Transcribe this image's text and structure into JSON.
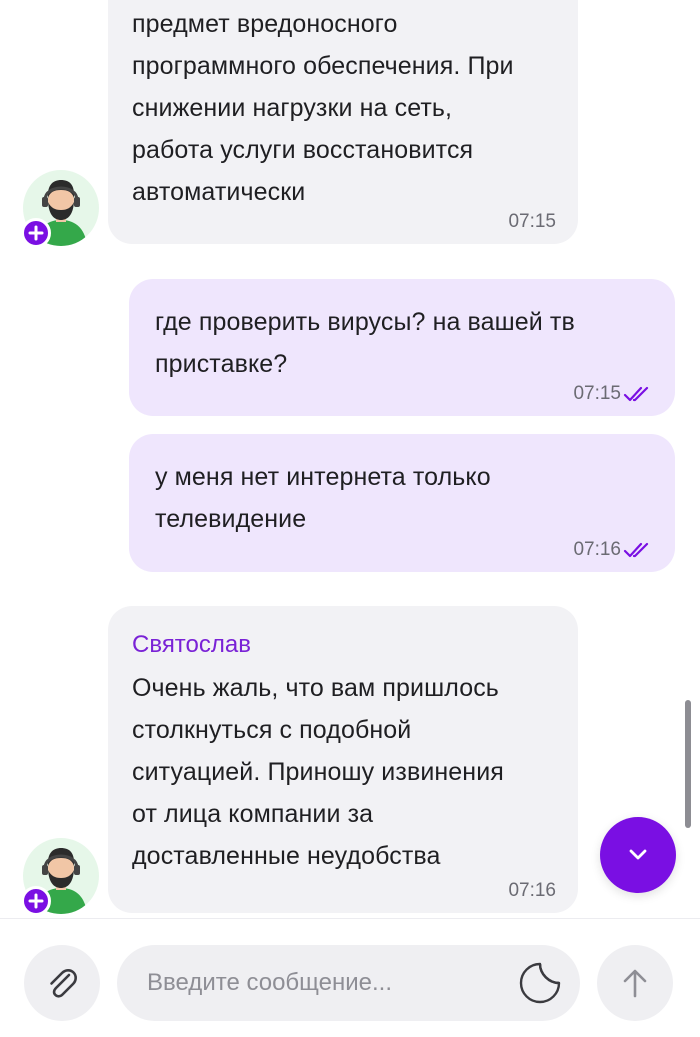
{
  "messages": [
    {
      "direction": "incoming",
      "text_lines": [
        "предмет вредоносного",
        "программного обеспечения. При",
        "снижении нагрузки на сеть,",
        "работа услуги восстановится",
        "автоматически"
      ],
      "time": "07:15"
    },
    {
      "direction": "outgoing",
      "text_lines": [
        "где проверить вирусы? на вашей тв",
        "приставке?"
      ],
      "time": "07:15",
      "status": "read"
    },
    {
      "direction": "outgoing",
      "text_lines": [
        "у меня нет интернета только",
        "телевидение"
      ],
      "time": "07:16",
      "status": "read"
    },
    {
      "direction": "incoming",
      "sender": "Святослав",
      "text_lines": [
        "Очень жаль, что вам пришлось",
        "столкнуться с подобной",
        "ситуацией. Приношу извинения",
        "от лица компании за",
        "доставленные неудобства"
      ],
      "time": "07:16"
    }
  ],
  "composer": {
    "placeholder": "Введите сообщение..."
  },
  "icons": {
    "attach": "paperclip-icon",
    "sticker": "sticker-icon",
    "send": "arrow-up-icon",
    "scroll_down": "chevron-down-icon",
    "read_status": "double-check-icon",
    "agent_avatar": "support-agent-avatar",
    "agent_badge": "plus-icon"
  },
  "colors": {
    "accent": "#7a0fe3",
    "incoming_bubble": "#f2f2f5",
    "outgoing_bubble": "#efe6fd",
    "sender_name": "#7a22d6"
  }
}
